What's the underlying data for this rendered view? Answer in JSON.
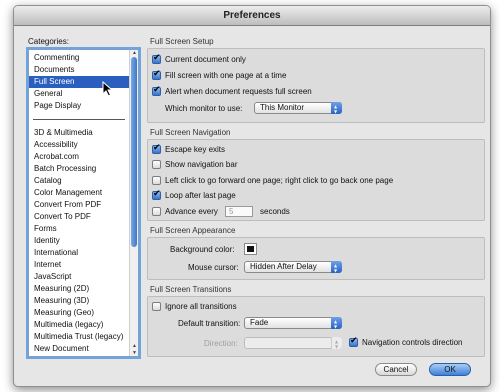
{
  "window": {
    "title": "Preferences"
  },
  "categories": {
    "label": "Categories:",
    "group1": [
      "Commenting",
      "Documents",
      "Full Screen",
      "General",
      "Page Display"
    ],
    "selected": "Full Screen",
    "group2": [
      "3D & Multimedia",
      "Accessibility",
      "Acrobat.com",
      "Batch Processing",
      "Catalog",
      "Color Management",
      "Convert From PDF",
      "Convert To PDF",
      "Forms",
      "Identity",
      "International",
      "Internet",
      "JavaScript",
      "Measuring (2D)",
      "Measuring (3D)",
      "Measuring (Geo)",
      "Multimedia (legacy)",
      "Multimedia Trust (legacy)",
      "New Document"
    ]
  },
  "setup": {
    "title": "Full Screen Setup",
    "current_doc": "Current document only",
    "fill_screen": "Fill screen with one page at a time",
    "alert": "Alert when document requests full screen",
    "monitor_label": "Which monitor to use:",
    "monitor_value": "This Monitor"
  },
  "navigation": {
    "title": "Full Screen Navigation",
    "escape": "Escape key exits",
    "show_nav": "Show navigation bar",
    "left_click": "Left click to go forward one page; right click to go back one page",
    "loop": "Loop after last page",
    "advance": "Advance every",
    "advance_value": "5",
    "seconds": "seconds"
  },
  "appearance": {
    "title": "Full Screen Appearance",
    "bg_label": "Background color:",
    "bg_color": "#111111",
    "cursor_label": "Mouse cursor:",
    "cursor_value": "Hidden After Delay"
  },
  "transitions": {
    "title": "Full Screen Transitions",
    "ignore": "Ignore all transitions",
    "default_label": "Default transition:",
    "default_value": "Fade",
    "direction_label": "Direction:",
    "nav_controls": "Navigation controls direction"
  },
  "buttons": {
    "cancel": "Cancel",
    "ok": "OK"
  }
}
